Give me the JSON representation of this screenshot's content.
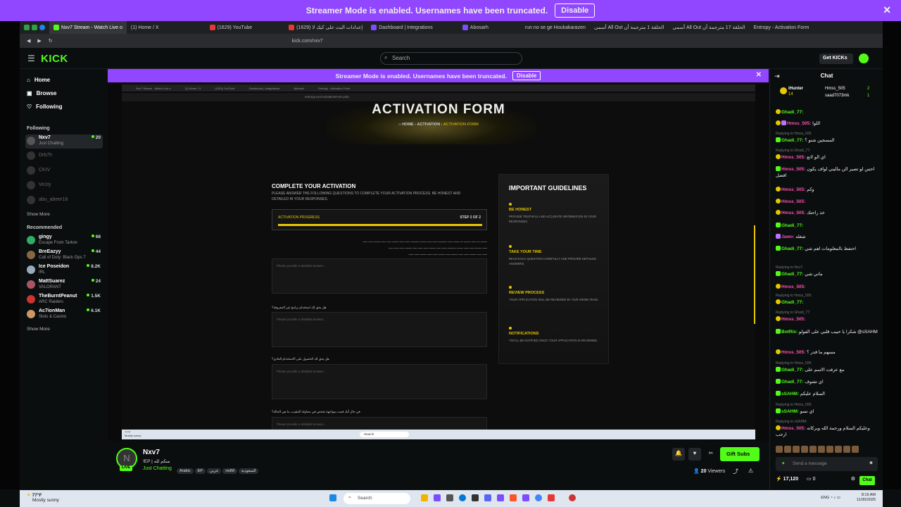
{
  "banner": {
    "text": "Streamer Mode is enabled. Usernames have been truncated.",
    "button": "Disable"
  },
  "browser": {
    "tabs": [
      "Nxv7 Stream - Watch Live o",
      "(1) Home / X",
      "(1629) YouTube",
      "(1629) إعدادات البث على كيك لا",
      "Dashboard | Integrations",
      "Abosarh",
      "run no se ge Houkakarazen",
      "أسمى All Out الحلقة 1 مترجمة أن",
      "أسمى All Out الحلقة 17 مترجمة أن",
      "Entropy - Activation Form"
    ],
    "url": "kick.com/nxv7"
  },
  "header": {
    "logo": "KICK",
    "search_placeholder": "Search",
    "get_kicks": "Get KICKs"
  },
  "sidebar": {
    "nav": [
      "Home",
      "Browse",
      "Following"
    ],
    "following_title": "Following",
    "following": [
      {
        "name": "Nxv7",
        "game": "Just Chatting",
        "viewers": "20"
      },
      {
        "name": "Drb7h"
      },
      {
        "name": "CKIV"
      },
      {
        "name": "Ve1ty"
      },
      {
        "name": "abu_abeer18"
      }
    ],
    "show_more": "Show More",
    "recommended_title": "Recommended",
    "recommended": [
      {
        "name": "gingy",
        "game": "Escape From Tarkov",
        "viewers": "68"
      },
      {
        "name": "BreEazyy",
        "game": "Call of Duty: Black Ops 7",
        "viewers": "44"
      },
      {
        "name": "Ice Poseidon",
        "game": "IRL",
        "viewers": "8.2K"
      },
      {
        "name": "MattSuarez",
        "game": "VALORANT",
        "viewers": "24"
      },
      {
        "name": "TheBurntPeanut",
        "game": "ARC Raiders",
        "viewers": "1.5K"
      },
      {
        "name": "Ac7ionMan",
        "game": "Slots & Casino",
        "viewers": "6.1K"
      }
    ],
    "show_more2": "Show More"
  },
  "video": {
    "banner": "Streamer Mode is enabled. Usernames have been truncated.",
    "banner_button": "Disable",
    "inner_url": "entropy.xxx/ActivationForm.php",
    "form": {
      "title": "ACTIVATION FORM",
      "breadcrumb_home": "HOME",
      "breadcrumb_mid": "ACTIVATION",
      "breadcrumb_current": "ACTIVATION FORM",
      "heading": "COMPLETE YOUR ACTIVATION",
      "subheading": "PLEASE ANSWER THE FOLLOWING QUESTIONS TO COMPLETE YOUR ACTIVATION PROCESS. BE HONEST AND DETAILED IN YOUR RESPONSES.",
      "progress_label": "ACTIVATION PROGRESS",
      "progress_step": "STEP 2 OF 2",
      "progress": 1.0,
      "placeholder": "Please provide a detailed answer...",
      "q2": "هل يحق لك استخدام برامج غير المعروفة؟",
      "q3": "هل يحق لك الحصول على الاستخدام العادي؟",
      "q4": "في حال أنك قمت بمواجهة شخص في محاولة التنقيب، ما هي الحالة؟"
    },
    "guide": {
      "title": "IMPORTANT GUIDELINES",
      "items": [
        {
          "h": "BE HONEST",
          "d": "PROVIDE TRUTHFUL AND ACCURATE INFORMATION IN YOUR RESPONSES."
        },
        {
          "h": "TAKE YOUR TIME",
          "d": "READ EACH QUESTION CAREFULLY AND PROVIDE DETAILED ANSWERS."
        },
        {
          "h": "REVIEW PROCESS",
          "d": "YOUR APPLICATION WILL BE REVIEWED BY OUR ADMIN TEAM."
        },
        {
          "h": "NOTIFICATIONS",
          "d": "YOU'LL BE NOTIFIED ONCE YOUR APPLICATION IS REVIEWED."
        }
      ]
    },
    "inner_task_search": "Search",
    "inner_weather": "77°F\nMostly sunny"
  },
  "channel": {
    "name": "Nxv7",
    "title": "!EP | منكم لله",
    "category": "Just Chatting",
    "tags": [
      "Arabic",
      "EP",
      "عربي",
      "redM",
      "السعودية"
    ],
    "live": "LIVE",
    "gift": "Gift Subs",
    "viewers": "20",
    "viewers_label": "Viewers"
  },
  "chat": {
    "title": "Chat",
    "pinned": [
      {
        "name": "iHunter",
        "sub": "14"
      },
      {
        "name": "Hmss_505",
        "sub": "2"
      },
      {
        "name": "saad7073mk",
        "sub": "1"
      }
    ],
    "messages": [
      {
        "user": "Ghadi_77:",
        "text": ""
      },
      {
        "user": "Hmss_505:",
        "text": "اللوا",
        "p": true
      },
      {
        "reply": "Replying to Hmss_505:",
        "user": "Ghadi_77:",
        "text": "المسجين شنو ؟"
      },
      {
        "reply": "Replying to Ghadi_77:",
        "user": "Hmss_505:",
        "text": "اي الو لاتع",
        "p": true
      },
      {
        "user": "Hmss_505:",
        "text": "احس لو تصير الن ماليني لواف يكون افضل",
        "p": true
      },
      {
        "user": "Hmss_505:",
        "text": "وكم",
        "p": true
      },
      {
        "user": "Hmss_505:",
        "text": "",
        "p": true
      },
      {
        "user": "Hmss_505:",
        "text": "خذ راحتك",
        "p": true
      },
      {
        "user": "Ghadi_77:",
        "text": ""
      },
      {
        "user": "Jawo:",
        "text": "شغله",
        "p": true
      },
      {
        "user": "Ghadi_77:",
        "text": "احتفظ بالمعلومات اهم شي"
      },
      {
        "reply": "Replying to Nxv7:",
        "user": "Ghadi_77:",
        "text": "ماني شي"
      },
      {
        "user": "Hmss_505:",
        "text": "",
        "p": true
      },
      {
        "reply": "Replying to Hmss_505:",
        "user": "Ghadi_77:",
        "text": ""
      },
      {
        "reply": "Replying to Ghadi_77:",
        "user": "Hmss_505:",
        "text": "",
        "p": true
      },
      {
        "user": "BotRix:",
        "text": "شكرا يا حبيب قلبي على الفولو @sSAHM"
      },
      {
        "user": "Hmss_505:",
        "text": "مسهم ما قدر ؟",
        "p": true
      },
      {
        "reply": "Replying to Hmss_505:",
        "user": "Ghadi_77:",
        "text": "مع عرفت الاسم على"
      },
      {
        "user": "Ghadi_77:",
        "text": "اي تشوف"
      },
      {
        "user": "sSAHM:",
        "text": "السلام عليكم"
      },
      {
        "reply": "Replying to Hmss_505:",
        "user": "sSAHM:",
        "text": "اي نسو"
      },
      {
        "reply": "Replying to sSAHM:",
        "user": "Hmss_505:",
        "text": "وعليكم السلام ورحمة الله وبركاته ارحب",
        "p": true
      }
    ],
    "placeholder": "Send a message",
    "points": "17,120",
    "count": "0",
    "chat_button": "Chat"
  },
  "taskbar": {
    "weather_temp": "77°F",
    "weather_desc": "Mostly sunny",
    "search": "Search",
    "lang": "ENG",
    "time": "8:16 AM",
    "date": "11/30/2025"
  }
}
